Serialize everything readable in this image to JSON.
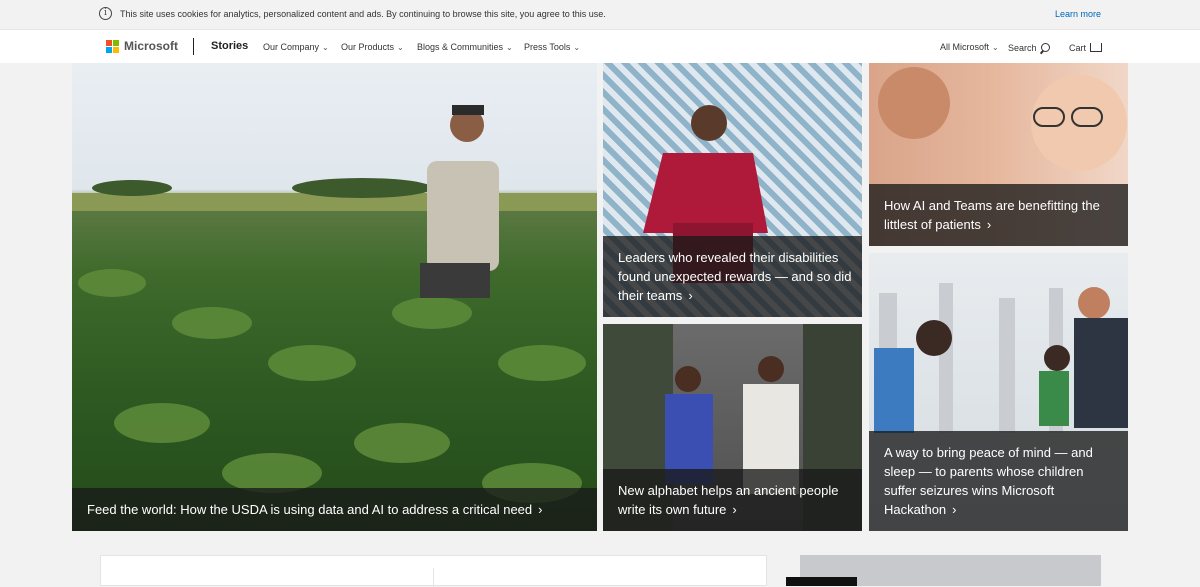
{
  "cookie_bar": {
    "info_icon": "i",
    "text": "This site uses cookies for analytics, personalized content and ads. By continuing to browse this site, you agree to this use.",
    "link": "Learn more"
  },
  "header": {
    "brand": "Microsoft",
    "section": "Stories",
    "nav": [
      {
        "label": "Our Company"
      },
      {
        "label": "Our Products"
      },
      {
        "label": "Blogs & Communities"
      },
      {
        "label": "Press Tools"
      }
    ],
    "all_microsoft": "All Microsoft",
    "search": "Search",
    "cart": "Cart",
    "chevron": "⌄"
  },
  "tiles": {
    "hero": {
      "caption": "Feed the world: How the USDA is using data and AI to address a critical need"
    },
    "disabilities": {
      "caption": "Leaders who revealed their disabilities found unexpected rewards — and so did their teams"
    },
    "ai_teams": {
      "caption": "How AI and Teams are benefitting the littlest of patients"
    },
    "alphabet": {
      "caption": "New alphabet helps an ancient people write its own future"
    },
    "hackathon": {
      "caption": "A way to bring peace of mind — and sleep — to parents whose children suffer seizures wins Microsoft Hackathon"
    },
    "arrow": "›"
  },
  "colors": {
    "brand_red": "#f25022",
    "brand_green": "#7fba00",
    "brand_blue": "#00a4ef",
    "brand_yellow": "#ffb900",
    "link_blue": "#0067b8"
  }
}
